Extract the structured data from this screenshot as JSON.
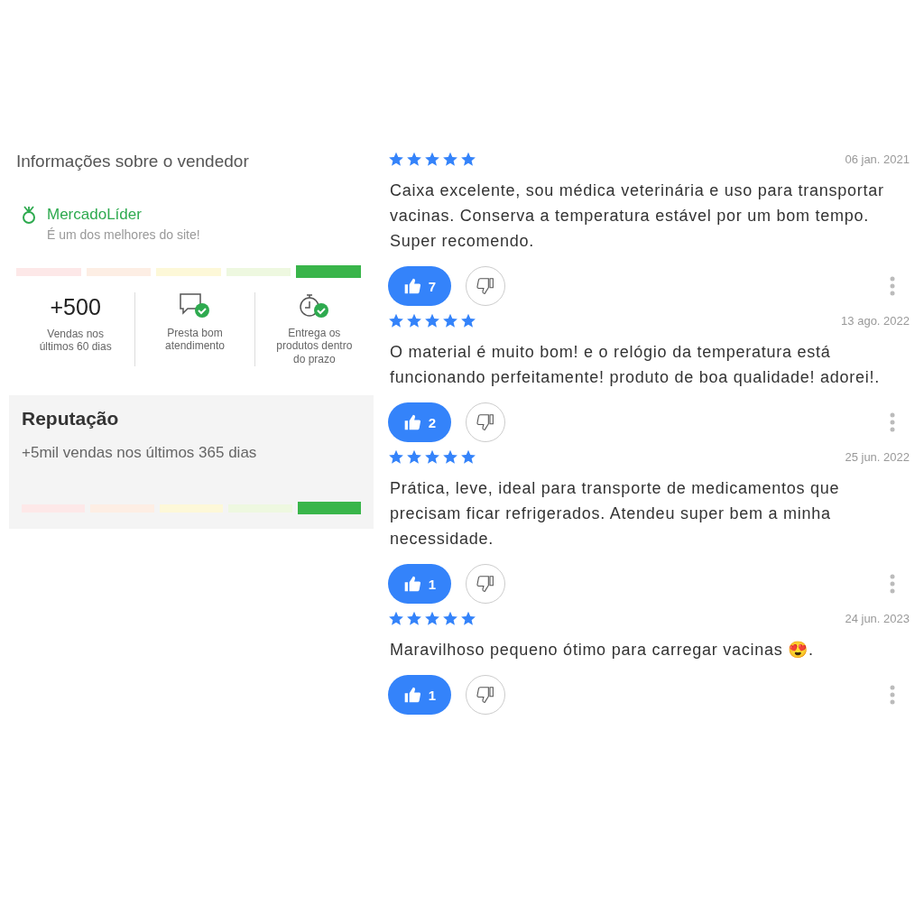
{
  "seller": {
    "heading": "Informações sobre o vendedor",
    "badge": {
      "title": "MercadoLíder",
      "subtitle": "É um dos melhores do site!"
    },
    "thermometer": [
      {
        "color": "#fde8e8",
        "selected": false
      },
      {
        "color": "#fdeee4",
        "selected": false
      },
      {
        "color": "#fdf8d8",
        "selected": false
      },
      {
        "color": "#eef8e0",
        "selected": false
      },
      {
        "color": "#39b54a",
        "selected": true
      }
    ],
    "stats": [
      {
        "kind": "number",
        "value": "+500",
        "label": "Vendas nos últimos 60 dias"
      },
      {
        "kind": "service",
        "label": "Presta bom atendimento"
      },
      {
        "kind": "delivery",
        "label": "Entrega os produtos dentro do prazo"
      }
    ]
  },
  "reputation": {
    "title": "Reputação",
    "text": "+5mil vendas nos últimos 365 dias",
    "thermometer": [
      {
        "color": "#fde8e8",
        "selected": false
      },
      {
        "color": "#fdeee4",
        "selected": false
      },
      {
        "color": "#fdf8d8",
        "selected": false
      },
      {
        "color": "#eef8e0",
        "selected": false
      },
      {
        "color": "#39b54a",
        "selected": true
      }
    ]
  },
  "reviews": [
    {
      "stars": 5,
      "date": "06 jan. 2021",
      "text": "Caixa excelente, sou médica veterinária e uso para transportar vacinas. Conserva a temperatura estável por um bom tempo. Super recomendo.",
      "likes": "7",
      "liked": true
    },
    {
      "stars": 5,
      "date": "13 ago. 2022",
      "text": "O material é muito bom! e o relógio da temperatura está funcionando perfeitamente! produto de boa qualidade! adorei!.",
      "likes": "2",
      "liked": true
    },
    {
      "stars": 5,
      "date": "25 jun. 2022",
      "text": "Prática, leve, ideal para transporte de medicamentos que precisam ficar refrigerados. Atendeu super bem a minha necessidade.",
      "likes": "1",
      "liked": true
    },
    {
      "stars": 5,
      "date": "24 jun. 2023",
      "text": "Maravilhoso pequeno ótimo para carregar vacinas 😍.",
      "likes": "1",
      "liked": true
    }
  ]
}
